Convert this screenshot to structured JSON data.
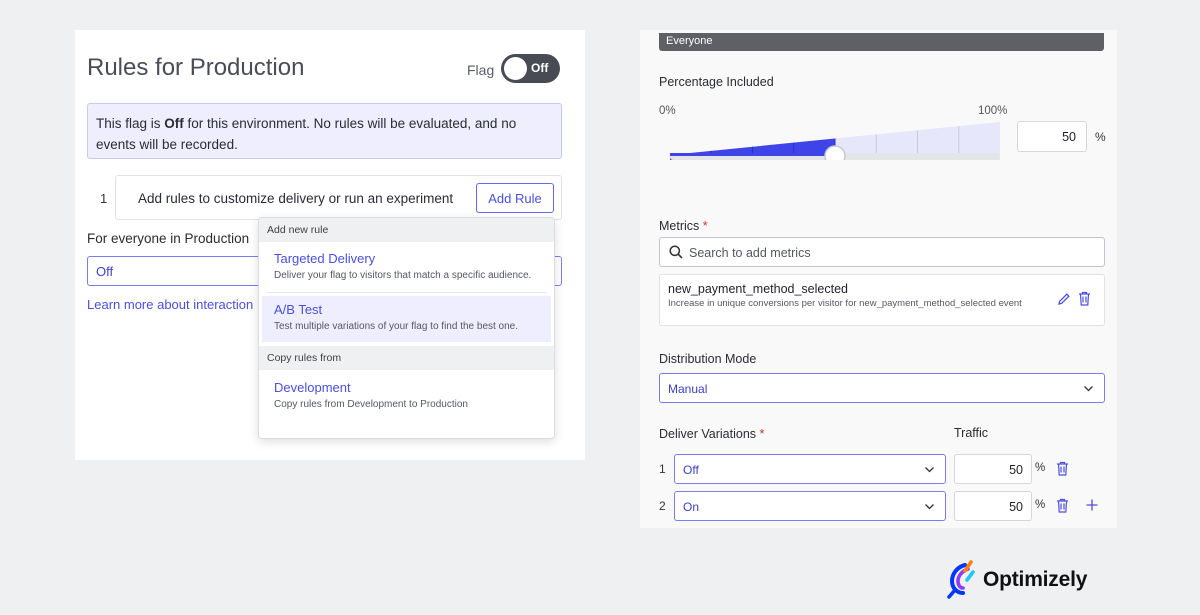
{
  "left": {
    "title": "Rules for Production",
    "flag_label": "Flag",
    "toggle_state": "Off",
    "notice_prefix": "This flag is ",
    "notice_bold": "Off",
    "notice_suffix": " for this environment. No rules will be evaluated, and no events will be recorded.",
    "rule_index": "1",
    "rule_prompt": "Add rules to customize delivery or run an experiment",
    "add_rule_label": "Add Rule",
    "everyone_label": "For everyone in Production",
    "everyone_value": "Off",
    "learn_more": "Learn more about interaction",
    "dropdown": {
      "header_new": "Add new rule",
      "targeted_title": "Targeted Delivery",
      "targeted_desc": "Deliver your flag to visitors that match a specific audience.",
      "ab_title": "A/B Test",
      "ab_desc": "Test multiple variations of your flag to find the best one.",
      "header_copy": "Copy rules from",
      "dev_title": "Development",
      "dev_desc": "Copy rules from Development to Production"
    }
  },
  "right": {
    "audience_bar": "Everyone",
    "percentage_label": "Percentage Included",
    "tick_min": "0%",
    "tick_max": "100%",
    "percentage_fraction": 0.5,
    "percentage_value": "50",
    "percent_sign": "%",
    "metrics_label": "Metrics",
    "required_mark": "*",
    "metrics_placeholder": "Search to add metrics",
    "metric_name": "new_payment_method_selected",
    "metric_desc": "Increase in unique conversions per visitor for new_payment_method_selected event",
    "distribution_label": "Distribution Mode",
    "distribution_value": "Manual",
    "deliver_label": "Deliver Variations",
    "traffic_label": "Traffic",
    "variations": [
      {
        "index": "1",
        "name": "Off",
        "traffic": "50"
      },
      {
        "index": "2",
        "name": "On",
        "traffic": "50"
      }
    ]
  },
  "brand": {
    "name": "Optimizely",
    "accent": "#4b4fe0"
  }
}
